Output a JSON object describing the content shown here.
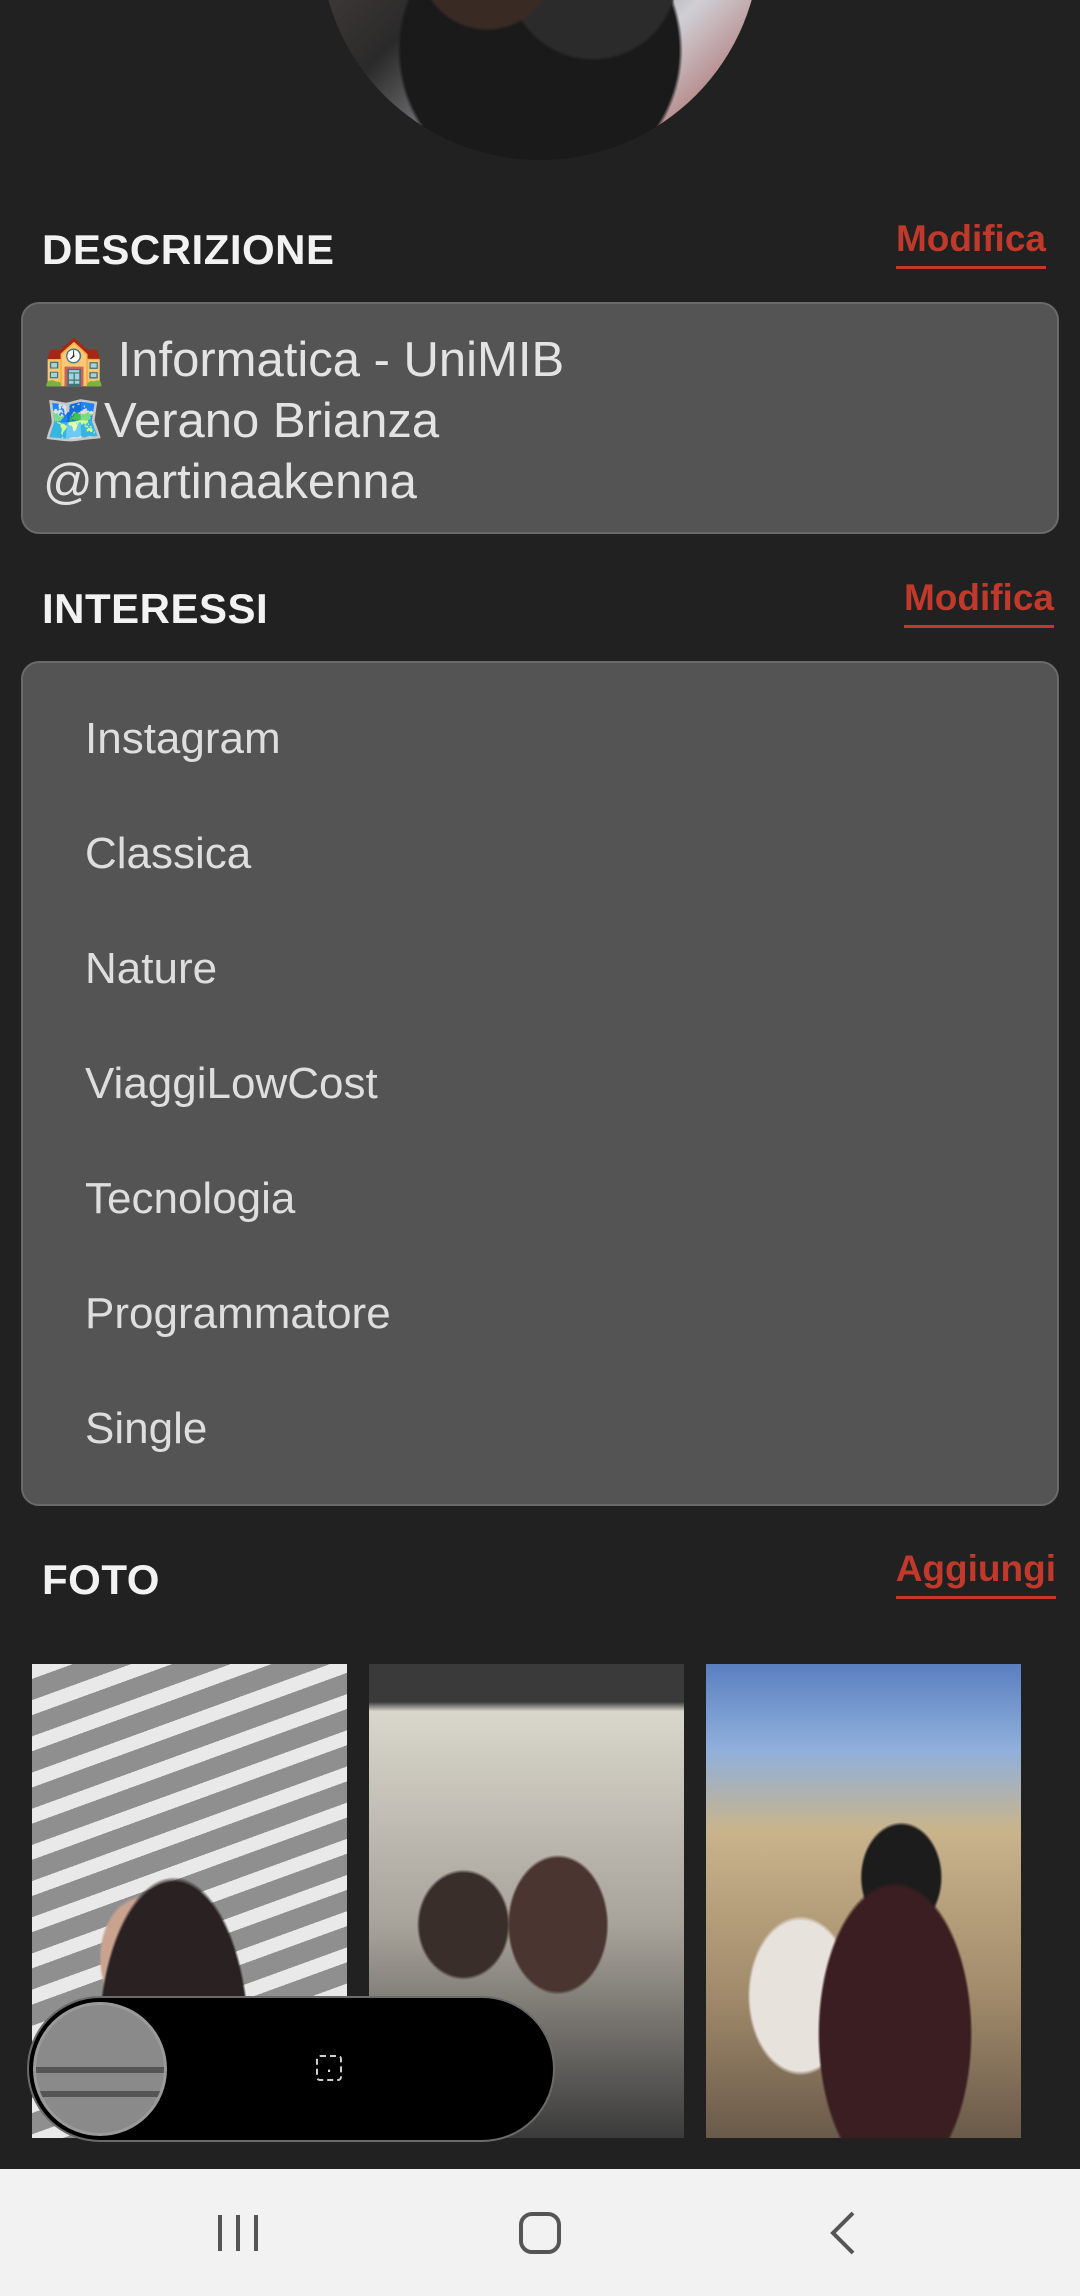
{
  "description": {
    "title": "DESCRIZIONE",
    "action": "Modifica",
    "text": "🏫 Informatica - UniMIB\n🗺️Verano Brianza\n@martinaakenna"
  },
  "interests": {
    "title": "INTERESSI",
    "action": "Modifica",
    "items": [
      {
        "label": "Instagram"
      },
      {
        "label": "Classica"
      },
      {
        "label": "Nature"
      },
      {
        "label": "ViaggiLowCost"
      },
      {
        "label": "Tecnologia"
      },
      {
        "label": "Programmatore"
      },
      {
        "label": "Single"
      }
    ]
  },
  "photos": {
    "title": "FOTO",
    "action": "Aggiungi"
  },
  "navbar": {
    "recents_icon": "recents-icon",
    "home_icon": "home-icon",
    "back_icon": "back-icon"
  },
  "colors": {
    "background": "#212121",
    "card": "#545454",
    "accent": "#c0392b",
    "navbar": "#f2f2f2"
  }
}
